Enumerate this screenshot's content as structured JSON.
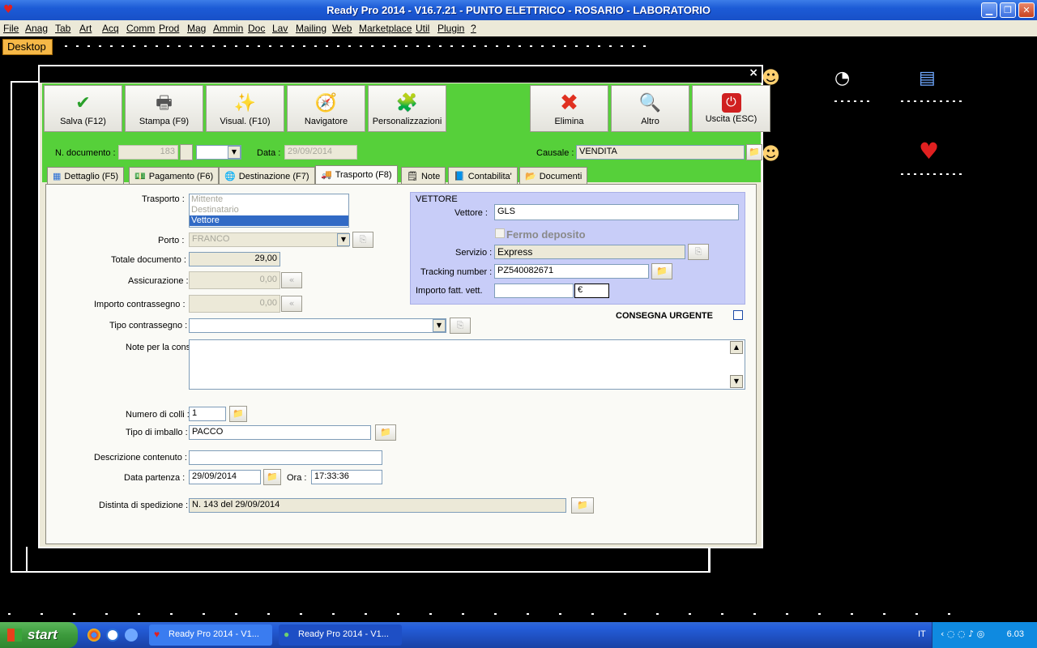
{
  "window": {
    "title": "Ready Pro 2014 - V16.7.21 - PUNTO ELETTRICO - ROSARIO - LABORATORIO",
    "minimize_glyph": "▁",
    "maximize_glyph": "❐",
    "close_glyph": "✕"
  },
  "menu": [
    "File",
    "Anag",
    "Tab",
    "Art",
    "Acq",
    "Comm",
    "Prod",
    "Mag",
    "Ammin",
    "Doc",
    "Lav",
    "Mailing",
    "Web",
    "Marketplace",
    "Util",
    "Plugin",
    "?"
  ],
  "desktop_tab": "Desktop",
  "dialog": {
    "close_glyph": "×",
    "toolbar": [
      {
        "label": "Salva (F12)",
        "icon": "check-icon",
        "glyph": "✔",
        "color": "#2aa02a"
      },
      {
        "label": "Stampa (F9)",
        "icon": "printer-icon",
        "glyph": "🖶",
        "color": "#555555"
      },
      {
        "label": "Visual. (F10)",
        "icon": "magic-wand-icon",
        "glyph": "✨",
        "color": "#d4a017"
      },
      {
        "label": "Navigatore",
        "icon": "compass-icon",
        "glyph": "🧭",
        "color": "#4a6fbf"
      },
      {
        "label": "Personalizzazioni",
        "icon": "puzzle-icon",
        "glyph": "🧩",
        "color": "#3aa53a"
      },
      {
        "label": "Elimina",
        "icon": "delete-x-icon",
        "glyph": "✖",
        "color": "#e03020"
      },
      {
        "label": "Altro",
        "icon": "magnifier-icon",
        "glyph": "🔍",
        "color": "#2a6fd6"
      },
      {
        "label": "Uscita (ESC)",
        "icon": "exit-power-icon",
        "glyph": "⏻",
        "color": "#d02020"
      }
    ],
    "header": {
      "ndoc_label": "N. documento :",
      "ndoc_value": "183",
      "data_label": "Data :",
      "data_value": "29/09/2014",
      "causale_label": "Causale :",
      "causale_value": "VENDITA"
    },
    "tabs": [
      {
        "label": "Dettaglio (F5)",
        "icon": "grid-icon",
        "glyph": "▦",
        "color": "#2a6fd6"
      },
      {
        "label": "Pagamento (F6)",
        "icon": "money-icon",
        "glyph": "💵",
        "color": "#3aa53a"
      },
      {
        "label": "Destinazione (F7)",
        "icon": "globe-icon",
        "glyph": "🌐",
        "color": "#2a6fd6"
      },
      {
        "label": "Trasporto (F8)",
        "icon": "truck-icon",
        "glyph": "🚚",
        "color": "#666666"
      },
      {
        "label": "Note",
        "icon": "note-icon",
        "glyph": "🗒",
        "color": "#c8a300"
      },
      {
        "label": "Contabilita'",
        "icon": "book-icon",
        "glyph": "📘",
        "color": "#2a6fd6"
      },
      {
        "label": "Documenti",
        "icon": "folder-icon",
        "glyph": "📂",
        "color": "#c8a300"
      }
    ],
    "active_tab": "Trasporto (F8)",
    "trasporto": {
      "label": "Trasporto :",
      "options": [
        "Mittente",
        "Destinatario",
        "Vettore"
      ],
      "selected": "Vettore"
    },
    "porto": {
      "label": "Porto :",
      "value": "FRANCO"
    },
    "totale": {
      "label": "Totale documento :",
      "value": "29,00"
    },
    "assicurazione": {
      "label": "Assicurazione :",
      "value": "0,00"
    },
    "contrassegno": {
      "label": "Importo contrassegno :",
      "value": "0,00"
    },
    "tipo_contrassegno": {
      "label": "Tipo contrassegno :",
      "value": ""
    },
    "note_consegna": {
      "label": "Note per la consegna",
      "value": ""
    },
    "vettore_box": {
      "legend": "VETTORE",
      "vettore_label": "Vettore :",
      "vettore_value": "GLS",
      "fermo_deposito": "Fermo deposito",
      "servizio_label": "Servizio :",
      "servizio_value": "Express",
      "tracking_label": "Tracking number :",
      "tracking_value": "PZ540082671",
      "importo_label": "Importo fatt. vett.",
      "importo_value": "",
      "currency": "€"
    },
    "consegna_urgente": "CONSEGNA URGENTE",
    "colli": {
      "label": "Numero di colli :",
      "value": "1"
    },
    "imballo": {
      "label": "Tipo di imballo :",
      "value": "PACCO"
    },
    "descrizione": {
      "label": "Descrizione contenuto :",
      "value": ""
    },
    "partenza": {
      "label": "Data partenza :",
      "value": "29/09/2014",
      "ora_label": "Ora :",
      "ora_value": "17:33:36"
    },
    "distinta": {
      "label": "Distinta di spedizione :",
      "value": "N. 143 del 29/09/2014"
    }
  },
  "taskbar": {
    "start": "start",
    "apps": [
      "Ready Pro 2014 - V1...",
      "Ready Pro 2014 - V1..."
    ],
    "lang": "IT",
    "clock": "6.03"
  }
}
